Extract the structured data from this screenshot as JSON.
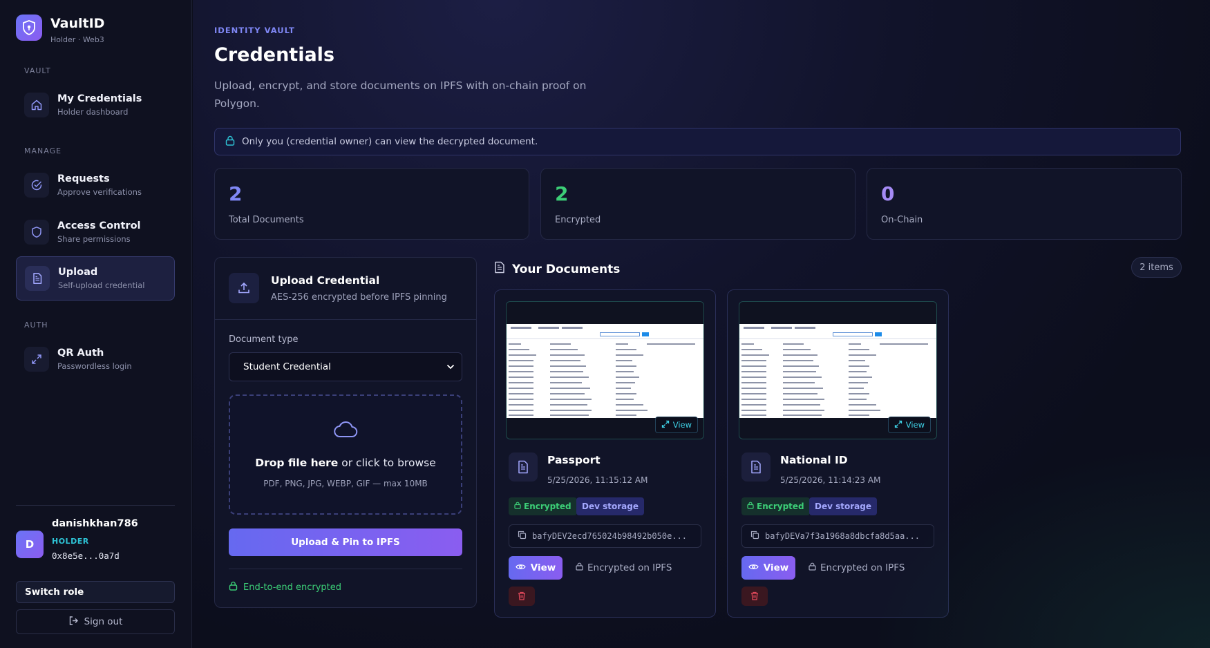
{
  "brand": {
    "name": "VaultID",
    "subtitle": "Holder · Web3"
  },
  "sidebar": {
    "sections": [
      {
        "label": "VAULT"
      },
      {
        "label": "MANAGE"
      },
      {
        "label": "AUTH"
      }
    ],
    "items": [
      {
        "title": "My Credentials",
        "subtitle": "Holder dashboard",
        "icon": "home-icon"
      },
      {
        "title": "Requests",
        "subtitle": "Approve verifications",
        "icon": "check-circle-icon"
      },
      {
        "title": "Access Control",
        "subtitle": "Share permissions",
        "icon": "shield-icon"
      },
      {
        "title": "Upload",
        "subtitle": "Self-upload credential",
        "icon": "document-icon",
        "active": true
      },
      {
        "title": "QR Auth",
        "subtitle": "Passwordless login",
        "icon": "expand-icon"
      }
    ]
  },
  "user": {
    "initial": "D",
    "name": "danishkhan786",
    "role": "HOLDER",
    "address": "0x8e5e...0a7d",
    "switch_role": "Switch role",
    "sign_out": "Sign out"
  },
  "header": {
    "eyebrow": "IDENTITY VAULT",
    "title": "Credentials",
    "description": "Upload, encrypt, and store documents on IPFS with on-chain proof on Polygon."
  },
  "notice": "Only you (credential owner) can view the decrypted document.",
  "stats": [
    {
      "value": "2",
      "label": "Total Documents",
      "color": "#7f87f5"
    },
    {
      "value": "2",
      "label": "Encrypted",
      "color": "#3ccf77"
    },
    {
      "value": "0",
      "label": "On-Chain",
      "color": "#a58bf5"
    }
  ],
  "upload": {
    "title": "Upload Credential",
    "subtitle": "AES-256 encrypted before IPFS pinning",
    "doc_type_label": "Document type",
    "doc_type_value": "Student Credential",
    "drop_bold": "Drop file here",
    "drop_rest": " or click to browse",
    "drop_hint": "PDF, PNG, JPG, WEBP, GIF — max 10MB",
    "button": "Upload & Pin to IPFS",
    "footer": "End-to-end encrypted"
  },
  "documents": {
    "heading": "Your Documents",
    "count": "2 items",
    "items": [
      {
        "title": "Passport",
        "date": "5/25/2026, 11:15:12 AM",
        "badges": [
          "Encrypted",
          "Dev storage"
        ],
        "cid": "bafyDEV2ecd765024b98492b050e...",
        "preview_view": "View",
        "view": "View",
        "status": "Encrypted on IPFS"
      },
      {
        "title": "National ID",
        "date": "5/25/2026, 11:14:23 AM",
        "badges": [
          "Encrypted",
          "Dev storage"
        ],
        "cid": "bafyDEVa7f3a1968a8dbcfa8d5aa...",
        "preview_view": "View",
        "view": "View",
        "status": "Encrypted on IPFS"
      }
    ]
  },
  "colors": {
    "accent": "#6a74f6",
    "success": "#3ccf77",
    "cyan": "#3fd2e6",
    "danger": "#e0485a"
  }
}
